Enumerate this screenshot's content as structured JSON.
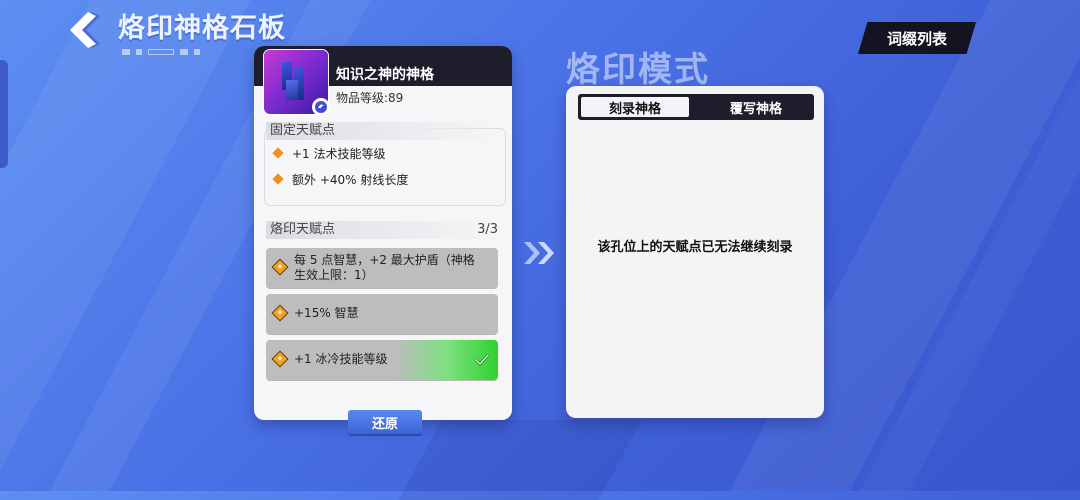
{
  "header": {
    "title": "烙印神格石板",
    "affix_list_label": "词缀列表"
  },
  "item": {
    "name": "知识之神的神格",
    "level": "物品等级:89"
  },
  "fixed_talents": {
    "heading": "固定天赋点",
    "rows": [
      "+1 法术技能等级",
      "额外 +40% 射线长度"
    ]
  },
  "brand_talents": {
    "heading": "烙印天赋点",
    "count": "3/3",
    "slots": [
      {
        "line1": "每 5 点智慧，+2 最大护盾（神格",
        "line2": "生效上限：1）",
        "completed": false
      },
      {
        "line1": "+15% 智慧",
        "line2": "",
        "completed": false
      },
      {
        "line1": "+1 冰冷技能等级",
        "line2": "",
        "completed": true
      }
    ]
  },
  "restore_label": "还原",
  "mode": {
    "title": "烙印模式",
    "tabs": [
      {
        "label": "刻录神格",
        "active": true
      },
      {
        "label": "覆写神格",
        "active": false
      }
    ],
    "message": "该孔位上的天赋点已无法继续刻录"
  },
  "colors": {
    "accent_orange": "#f2901c",
    "success_green": "#2fd12f",
    "dark_header": "#1d1d2b"
  }
}
